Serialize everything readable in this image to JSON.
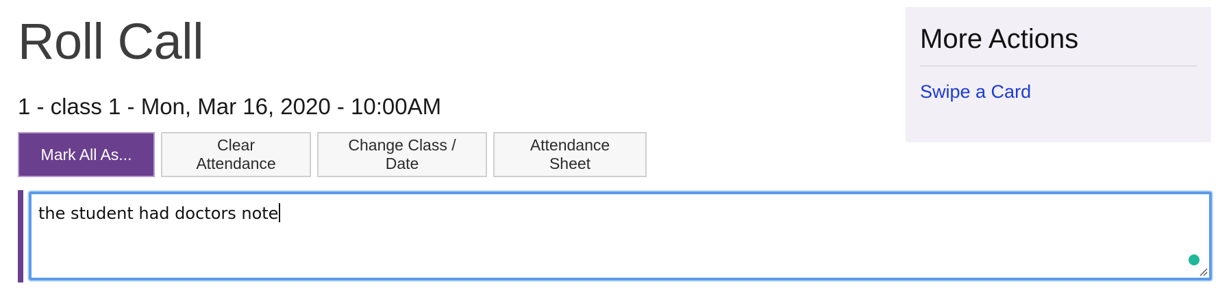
{
  "page": {
    "title": "Roll Call",
    "subtitle": "1 - class 1 - Mon, Mar 16, 2020 - 10:00AM"
  },
  "toolbar": {
    "mark_all_label": "Mark All As...",
    "clear_label": "Clear Attendance",
    "change_label": "Change Class / Date",
    "sheet_label": "Attendance Sheet"
  },
  "note": {
    "value": "the student had doctors note"
  },
  "sidebar": {
    "title": "More Actions",
    "links": [
      {
        "label": "Swipe a Card"
      }
    ]
  },
  "icons": {
    "grammar": "grammar-check-icon",
    "resize": "resize-handle-icon"
  },
  "colors": {
    "primary": "#6a3f8e",
    "link": "#1c3ad6",
    "focus": "#5b9bea",
    "sidebar_bg": "#f2f0f6",
    "grammar_dot": "#20b79a"
  }
}
